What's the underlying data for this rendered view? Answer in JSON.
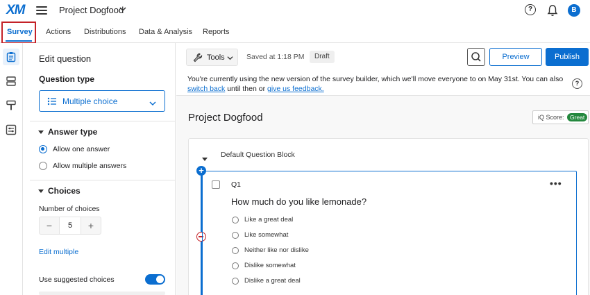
{
  "header": {
    "logo": "XM",
    "project_name": "Project Dogfood",
    "avatar_initial": "B"
  },
  "nav": {
    "tabs": [
      {
        "label": "Survey",
        "active": true
      },
      {
        "label": "Actions"
      },
      {
        "label": "Distributions"
      },
      {
        "label": "Data & Analysis"
      },
      {
        "label": "Reports"
      }
    ]
  },
  "panel": {
    "title": "Edit question",
    "question_type_label": "Question type",
    "question_type_value": "Multiple choice",
    "answer_type_heading": "Answer type",
    "answer_options": [
      "Allow one answer",
      "Allow multiple answers"
    ],
    "choices_heading": "Choices",
    "number_of_choices_label": "Number of choices",
    "number_of_choices_value": "5",
    "edit_multiple": "Edit multiple",
    "suggested_choices_label": "Use suggested choices",
    "suggested_choices_on": true
  },
  "toolbar": {
    "tools_label": "Tools",
    "saved_text": "Saved at 1:18 PM",
    "draft_label": "Draft",
    "preview_label": "Preview",
    "publish_label": "Publish"
  },
  "banner": {
    "line1": "You're currently using the new version of the survey builder, which we'll move everyone to on May 31st. You can also",
    "link1": "switch back",
    "middle": " until then or ",
    "link2": "give us feedback."
  },
  "survey": {
    "title": "Project Dogfood",
    "iq_score_label": "iQ Score:",
    "iq_score_value": "Great",
    "block_title": "Default Question Block",
    "question": {
      "number": "Q1",
      "text": "How much do you like lemonade?",
      "choices": [
        "Like a great deal",
        "Like somewhat",
        "Neither like nor dislike",
        "Dislike somewhat",
        "Dislike a great deal"
      ]
    }
  },
  "colors": {
    "accent": "#0b6ed0",
    "highlight_box": "#c42127",
    "great_badge": "#24883e"
  }
}
